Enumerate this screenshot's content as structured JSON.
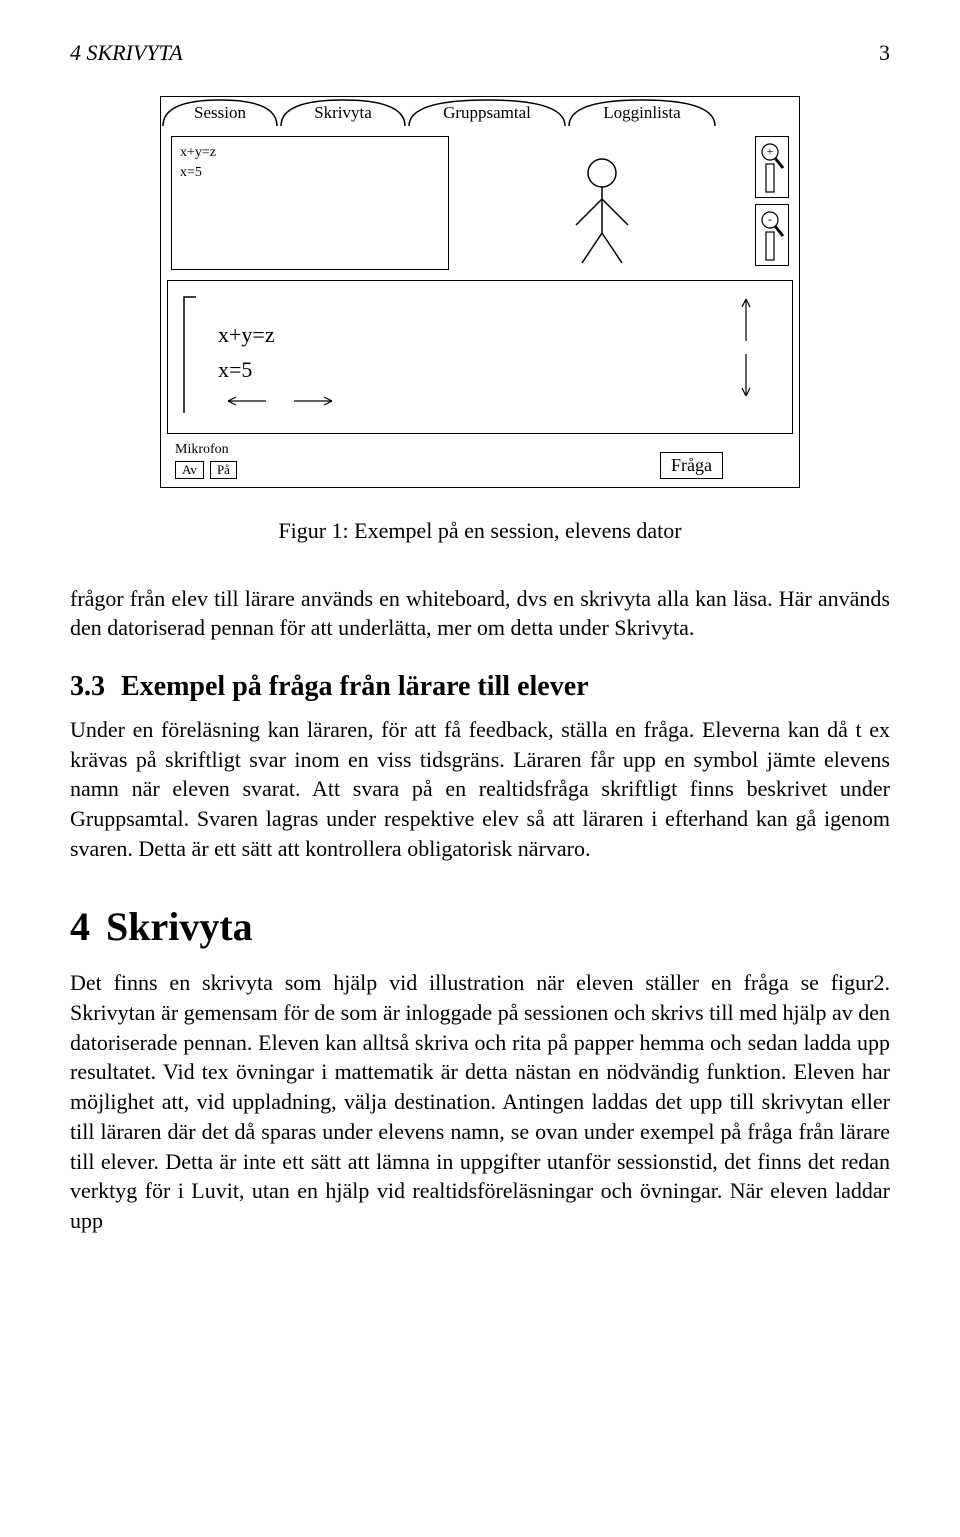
{
  "running_head": {
    "left": "4   SKRIVYTA",
    "right": "3"
  },
  "figure": {
    "tabs": [
      "Session",
      "Skrivyta",
      "Gruppsamtal",
      "Logginlista"
    ],
    "notebox": {
      "line1": "x+y=z",
      "line2": "x=5"
    },
    "zoom": {
      "plus": "+",
      "minus": "-"
    },
    "lowerbox": {
      "line1": "x+y=z",
      "line2": "x=5"
    },
    "mic": {
      "label": "Mikrofon",
      "off": "Av",
      "on": "På"
    },
    "ask_btn": "Fråga",
    "caption": "Figur 1: Exempel på en session, elevens dator"
  },
  "para1": "frågor från elev till lärare används en whiteboard, dvs en skrivyta alla kan läsa. Här används den datoriserad pennan för att underlätta, mer om detta under Skrivyta.",
  "sec33": {
    "num": "3.3",
    "title": "Exempel på fråga från lärare till elever"
  },
  "para2": "Under en föreläsning kan läraren, för att få feedback, ställa en fråga. Eleverna kan då t ex krävas på skriftligt svar inom en viss tidsgräns. Läraren får upp en symbol jämte elevens namn när eleven svarat. Att svara på en realtidsfråga skriftligt finns beskrivet under Gruppsamtal. Svaren lagras under respektive elev så att läraren i efterhand kan gå igenom svaren. Detta är ett sätt att kontrollera obligatorisk närvaro.",
  "chap4": {
    "num": "4",
    "title": "Skrivyta"
  },
  "para3": "Det finns en skrivyta som hjälp vid illustration när eleven ställer en fråga se figur2. Skrivytan är gemensam för de som är inloggade på sessionen och skrivs till med hjälp av den datoriserade pennan. Eleven kan alltså skriva och rita på papper hemma och sedan ladda upp resultatet. Vid tex övningar i mattematik är detta nästan en nödvändig funktion. Eleven har möjlighet att, vid uppladning, välja destination. Antingen laddas det upp till skrivytan eller till läraren där det då sparas under elevens namn, se ovan under exempel på fråga från lärare till elever. Detta är inte ett sätt att lämna in uppgifter utanför sessionstid, det finns det redan verktyg för i Luvit, utan en hjälp vid realtidsföreläsningar och övningar. När eleven laddar upp"
}
